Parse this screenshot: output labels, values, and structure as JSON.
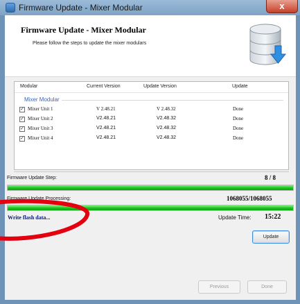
{
  "window": {
    "title": "Firmware Update - Mixer Modular",
    "close_label": "x"
  },
  "header": {
    "title": "Firmware Update - Mixer Modular",
    "subtitle": "Please follow the steps to update the mixer modulars",
    "icon": "database-download-icon"
  },
  "table": {
    "columns": [
      "Modular",
      "Current Version",
      "Update Version",
      "Update"
    ],
    "group_label": "Mixer Modular",
    "rows": [
      {
        "name": "Mixer Unit 1",
        "checked": true,
        "current": "V 2.48.21",
        "update": "V 2.48.32",
        "status": "Done"
      },
      {
        "name": "Mixer Unit 2",
        "checked": true,
        "current": "V2.48.21",
        "update": "V2.48.32",
        "status": "Done"
      },
      {
        "name": "Mixer Unit 3",
        "checked": true,
        "current": "V2.48.21",
        "update": "V2.48.32",
        "status": "Done"
      },
      {
        "name": "Mixer Unit 4",
        "checked": true,
        "current": "V2.48.21",
        "update": "V2.48.32",
        "status": "Done"
      }
    ]
  },
  "progress": {
    "step_label": "Firmware Update Step:",
    "step_count": "8 / 8",
    "step_fraction": 1.0,
    "processing_label": "Firmware Update Processing:",
    "processing_count": "1068055/1068055",
    "processing_fraction": 1.0
  },
  "status": {
    "message": "Write flash data...",
    "time_label": "Update Time:",
    "time_value": "15:22"
  },
  "buttons": {
    "update": "Update",
    "previous": "Previous",
    "done": "Done"
  },
  "colors": {
    "progress_green": "#17c21c",
    "annotation_red": "#e3000f",
    "title_bar": "#8aaed0"
  }
}
